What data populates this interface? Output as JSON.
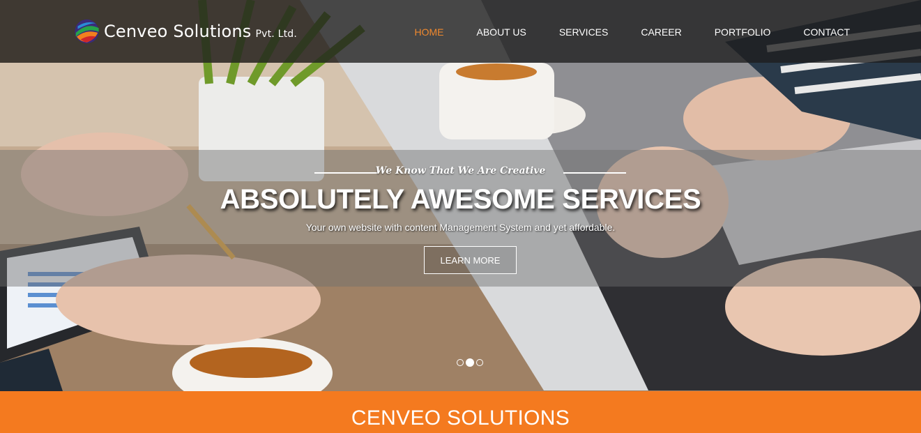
{
  "brand": {
    "name": "Cenveo Solutions",
    "suffix": "Pvt. Ltd.",
    "logo": "globe-swirl-logo"
  },
  "nav": {
    "items": [
      {
        "label": "HOME",
        "active": true
      },
      {
        "label": "ABOUT US",
        "active": false
      },
      {
        "label": "SERVICES",
        "active": false
      },
      {
        "label": "CAREER",
        "active": false
      },
      {
        "label": "PORTFOLIO",
        "active": false
      },
      {
        "label": "CONTACT",
        "active": false
      }
    ],
    "active_color": "#f0892e"
  },
  "hero": {
    "tagline": "We Know That We Are Creative",
    "headline": "ABSOLUTELY AWESOME SERVICES",
    "subline": "Your own website with content Management System and yet affordable.",
    "cta": "LEARN MORE",
    "slides_total": 3,
    "slide_active": 2
  },
  "section": {
    "title": "CENVEO SOLUTIONS",
    "color": "#f47a1f"
  }
}
